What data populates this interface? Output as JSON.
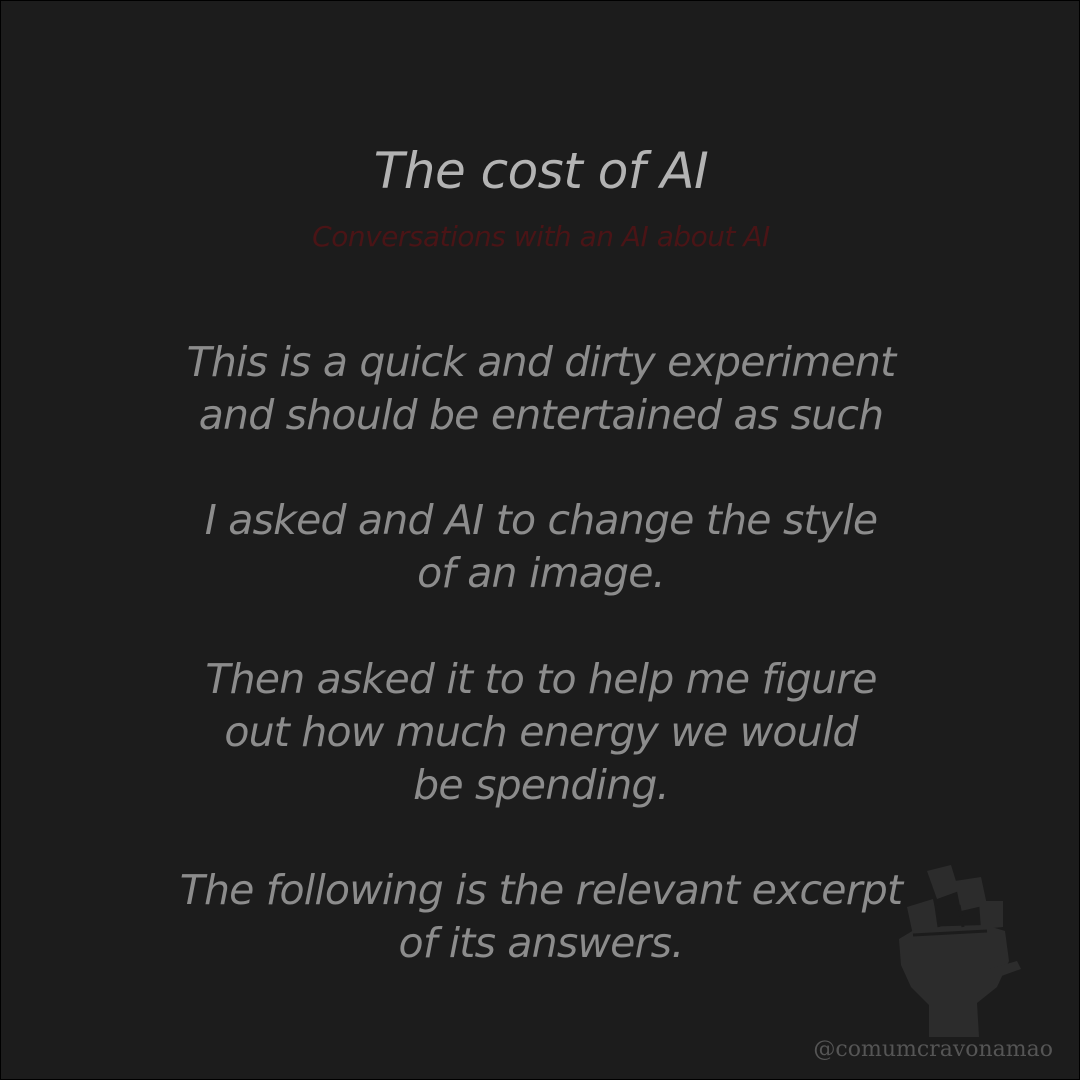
{
  "header": {
    "title": "The cost of AI",
    "subtitle": "Conversations with an AI about AI"
  },
  "body": {
    "paragraphs": [
      "This is a quick and dirty experiment\nand should be entertained as such",
      "I asked and AI to change the style\nof an image.",
      "Then asked it to to help me figure\nout how much energy we would\nbe spending.",
      "The following is the relevant excerpt\nof its answers."
    ]
  },
  "watermark": {
    "icon": "raised-fist-icon",
    "handle": "@comumcravonamao"
  },
  "colors": {
    "background": "#1c1c1c",
    "border": "#000000",
    "title": "#b3b3b3",
    "subtitle": "#4a1416",
    "body": "#8c8c8c",
    "watermark": "#2c2c2c"
  }
}
